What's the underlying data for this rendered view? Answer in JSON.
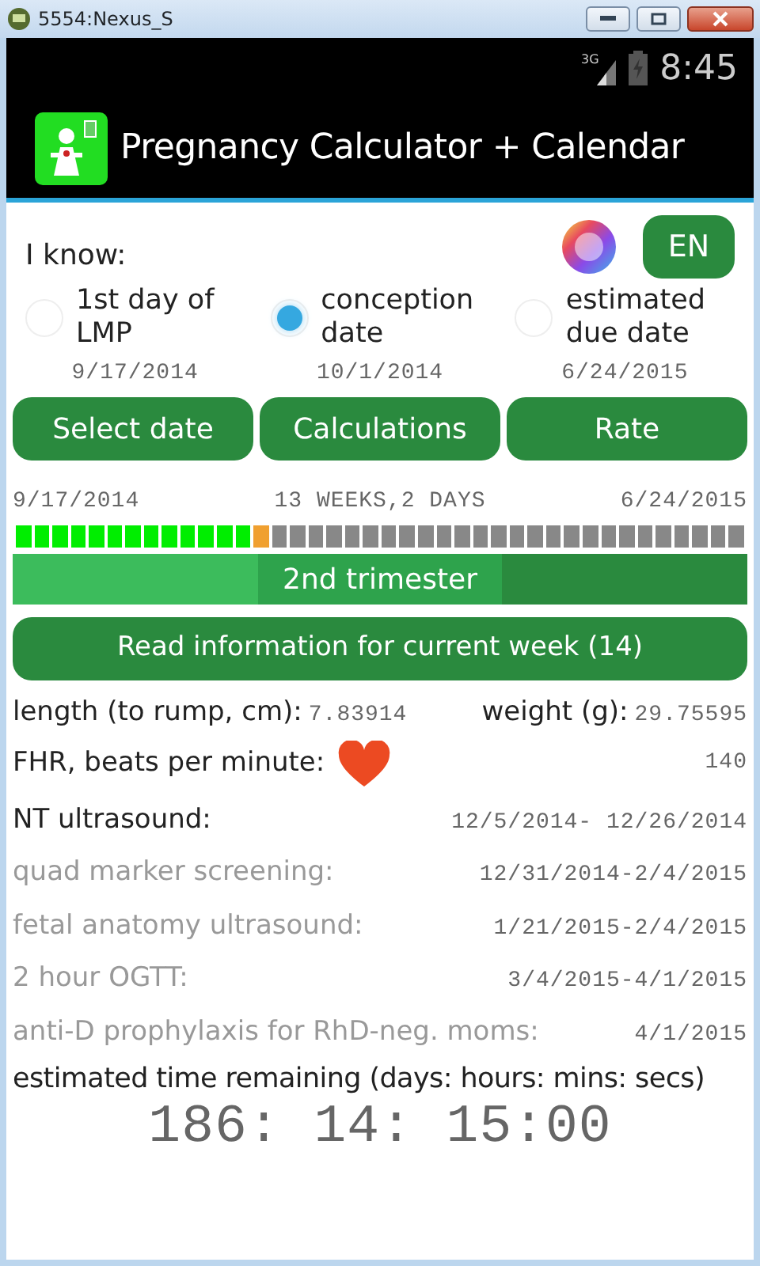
{
  "window": {
    "title": "5554:Nexus_S"
  },
  "status_bar": {
    "network": "3G",
    "time": "8:45"
  },
  "app_bar": {
    "title": "Pregnancy Calculator + Calendar"
  },
  "know_label": "I know:",
  "language_button": "EN",
  "options": [
    {
      "label": "1st day of LMP",
      "date": "9/17/2014",
      "selected": false
    },
    {
      "label": "conception date",
      "date": "10/1/2014",
      "selected": true
    },
    {
      "label": "estimated due date",
      "date": "6/24/2015",
      "selected": false
    }
  ],
  "buttons": [
    "Select date",
    "Calculations",
    "Rate"
  ],
  "progress": {
    "start": "9/17/2014",
    "elapsed": "13 WEEKS,2 DAYS",
    "end": "6/24/2015",
    "level": 0.325
  },
  "trimesters": [
    {
      "kind": "past"
    },
    {
      "kind": "current",
      "label": "2nd trimester"
    },
    {
      "kind": "future"
    }
  ],
  "info_button": "Read information for current week (14)",
  "length": {
    "label": "length (to rump, cm):",
    "value": "7.83914"
  },
  "weight": {
    "label": "weight (g):",
    "value": "29.75595"
  },
  "fhr": {
    "label": "FHR, beats per minute:",
    "value": "140"
  },
  "events": [
    {
      "label": "NT ultrasound:",
      "dates": "12/5/2014- 12/26/2014",
      "active": true
    },
    {
      "label": "quad marker screening:",
      "dates": "12/31/2014-2/4/2015",
      "active": false
    },
    {
      "label": "fetal anatomy ultrasound:",
      "dates": "1/21/2015-2/4/2015",
      "active": false
    },
    {
      "label": "2 hour OGTT:",
      "dates": "3/4/2015-4/1/2015",
      "active": false
    },
    {
      "label": "anti-D prophylaxis for RhD-neg. moms:",
      "dates": "4/1/2015",
      "active": false
    }
  ],
  "remaining": {
    "label": "estimated time remaining (days: hours: mins: secs)",
    "value": "186: 14: 15:00"
  }
}
